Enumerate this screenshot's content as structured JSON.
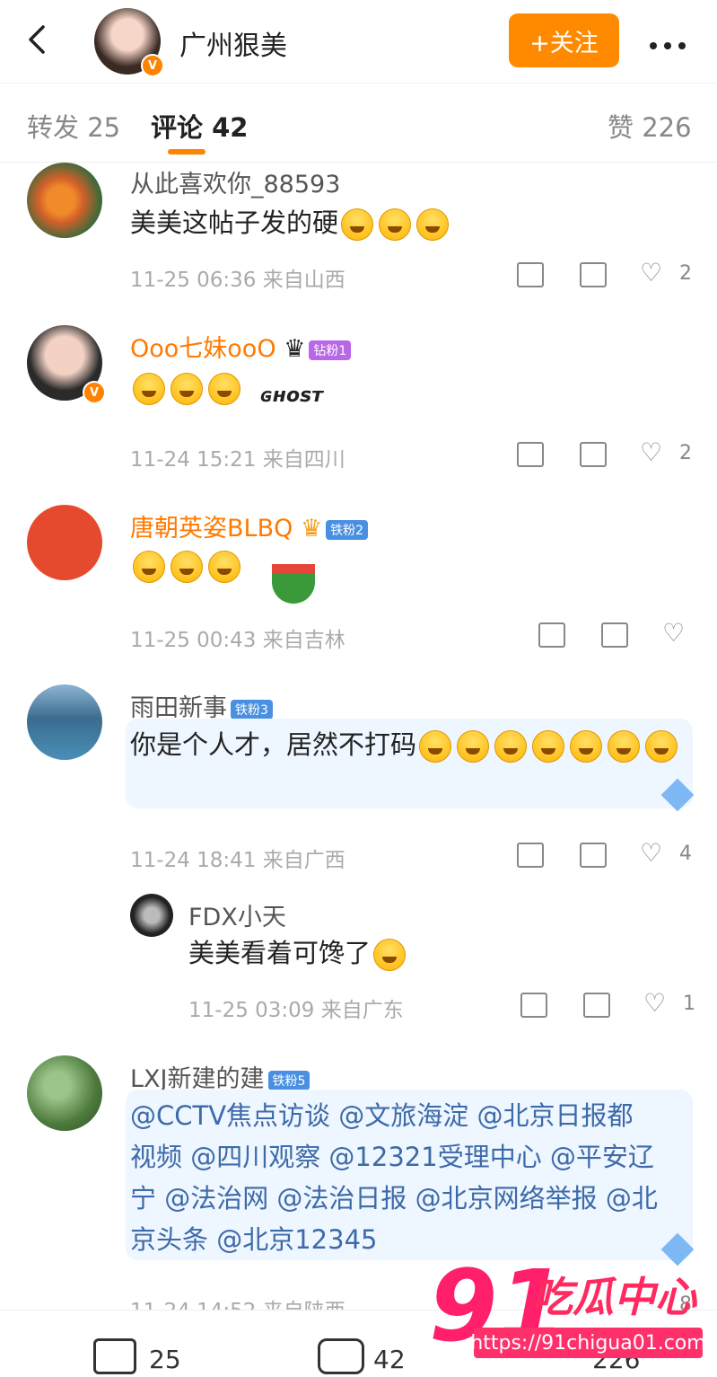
{
  "header": {
    "name": "广州狠美",
    "follow_label": "+关注",
    "verified": "V"
  },
  "tabs": {
    "repost": "转发 25",
    "comment": "评论 42",
    "like": "赞 226"
  },
  "comments": [
    {
      "user": "从此喜欢你_88593",
      "text": "美美这帖子发的硬",
      "meta": "11-25 06:36 来自山西",
      "likes": "2"
    },
    {
      "user": "Ooo七妹ooO",
      "badge": "钻粉1",
      "meta": "11-24 15:21 来自四川",
      "likes": "2"
    },
    {
      "user": "唐朝英姿BLBQ",
      "badge": "铁粉2",
      "meta": "11-25 00:43 来自吉林"
    },
    {
      "user": "雨田新事",
      "badge": "铁粉3",
      "text": "你是个人才，居然不打码",
      "meta": "11-24 18:41 来自广西",
      "likes": "4"
    },
    {
      "user": "FDX小天",
      "text": "美美看着可馋了",
      "meta": "11-25 03:09 来自广东",
      "likes": "1"
    },
    {
      "user": "LXJ新建的建",
      "badge": "铁粉5",
      "text_line1": "@CCTV焦点访谈 @文旅海淀 @北京日报都",
      "text_line2": "视频 @四川观察 @12321受理中心 @平安辽",
      "text_line3": "宁 @法治网 @法治日报 @北京网络举报 @北",
      "text_line4": "京头条 @北京12345",
      "meta": "11-24 14:52 来自陕西",
      "likes": "8"
    }
  ],
  "bottom": {
    "repost": "25",
    "comment": "42",
    "like": "226"
  },
  "watermark": {
    "number": "91",
    "text": "吃瓜中心",
    "url": "https://91chigua01.com"
  },
  "colors": {
    "accent": "#ff8200",
    "link": "#3d6aa8"
  }
}
